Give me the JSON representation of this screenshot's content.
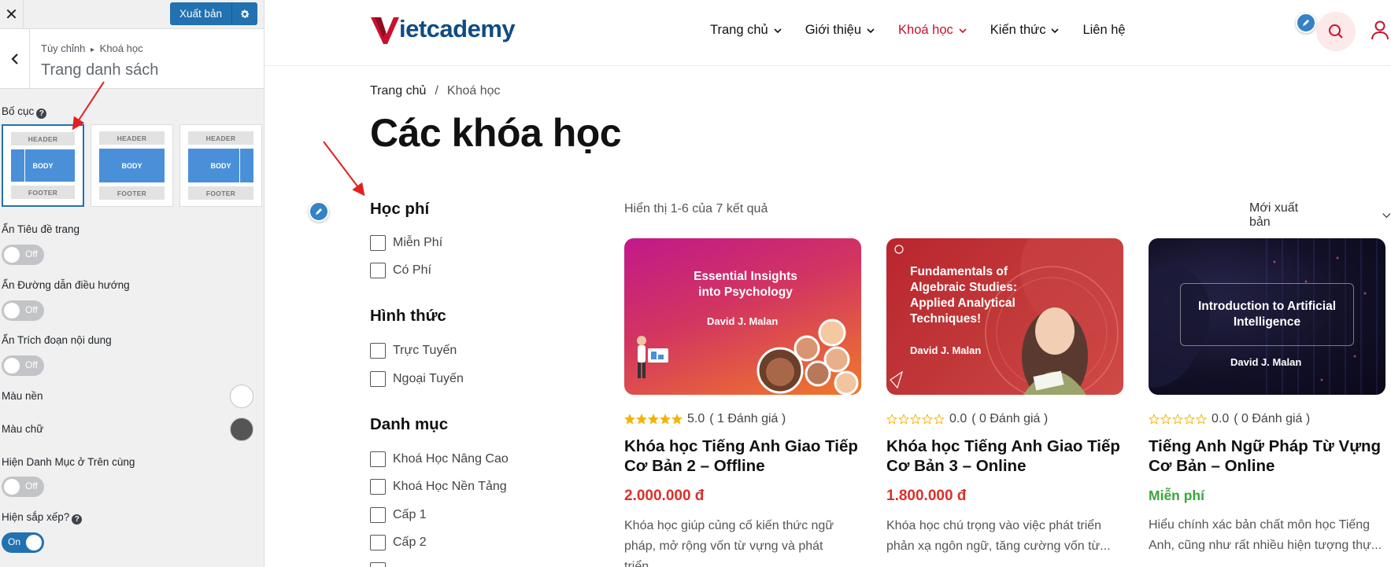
{
  "customizer": {
    "close_label": "✕",
    "publish_label": "Xuất bản",
    "breadcrumb": {
      "root": "Tùy chỉnh",
      "separator": "▸",
      "current": "Khoá học"
    },
    "section_title": "Trang danh sách",
    "layout": {
      "label": "Bố cục",
      "options": [
        {
          "header": "HEADER",
          "body": "BODY",
          "footer": "FOOTER",
          "variant": "left-sidebar",
          "selected": true
        },
        {
          "header": "HEADER",
          "body": "BODY",
          "footer": "FOOTER",
          "variant": "full-width",
          "selected": false
        },
        {
          "header": "HEADER",
          "body": "BODY",
          "footer": "FOOTER",
          "variant": "right-sidebar",
          "selected": false
        }
      ]
    },
    "controls": [
      {
        "label": "Ẩn Tiêu đề trang",
        "state": "Off"
      },
      {
        "label": "Ẩn Đường dẫn điều hướng",
        "state": "Off"
      },
      {
        "label": "Ẩn Trích đoạn nội dung",
        "state": "Off"
      }
    ],
    "bg_color": {
      "label": "Màu nền",
      "value": "#ffffff"
    },
    "text_color": {
      "label": "Màu chữ",
      "value": "#555555"
    },
    "show_category_top": {
      "label": "Hiện Danh Mục ở Trên cùng",
      "state": "Off"
    },
    "show_sort": {
      "label": "Hiện sắp xếp?",
      "state": "On"
    }
  },
  "site": {
    "logo": {
      "letter": "V",
      "text": "ietcademy"
    },
    "nav": [
      {
        "label": "Trang chủ",
        "dropdown": true,
        "active": false
      },
      {
        "label": "Giới thiệu",
        "dropdown": true,
        "active": false
      },
      {
        "label": "Khoá học",
        "dropdown": true,
        "active": true
      },
      {
        "label": "Kiến thức",
        "dropdown": true,
        "active": false
      },
      {
        "label": "Liên hệ",
        "dropdown": false,
        "active": false
      }
    ],
    "breadcrumb": {
      "home": "Trang chủ",
      "sep": "/",
      "current": "Khoá học"
    },
    "page_title": "Các khóa học",
    "filters": [
      {
        "title": "Học phí",
        "options": [
          "Miễn Phí",
          "Có Phí"
        ]
      },
      {
        "title": "Hình thức",
        "options": [
          "Trực Tuyến",
          "Ngoại Tuyến"
        ]
      },
      {
        "title": "Danh mục",
        "options": [
          "Khoá Học Nâng Cao",
          "Khoá Học Nền Tảng",
          "Cấp 1",
          "Cấp 2"
        ]
      }
    ],
    "results_text": "Hiển thị 1-6 của 7 kết quả",
    "sort_label": "Mới xuất bản",
    "courses": [
      {
        "thumb_title": "Essential Insights into Psychology",
        "thumb_author": "David J. Malan",
        "stars": 5,
        "rating": "5.0",
        "reviews": "( 1 Đánh giá )",
        "title": "Khóa học Tiếng Anh Giao Tiếp Cơ Bản 2 – Offline",
        "price": "2.000.000 đ",
        "free": false,
        "excerpt": "Khóa học giúp củng cố kiến thức ngữ pháp, mở rộng vốn từ vựng và phát triển..."
      },
      {
        "thumb_title": "Fundamentals of Algebraic Studies: Applied Analytical Techniques!",
        "thumb_author": "David J. Malan",
        "stars": 0,
        "rating": "0.0",
        "reviews": "( 0 Đánh giá )",
        "title": "Khóa học Tiếng Anh Giao Tiếp Cơ Bản 3 – Online",
        "price": "1.800.000 đ",
        "free": false,
        "excerpt": "Khóa học chú trọng vào việc phát triển phản xạ ngôn ngữ, tăng cường vốn từ..."
      },
      {
        "thumb_title": "Introduction to Artificial Intelligence",
        "thumb_author": "David J. Malan",
        "stars": 0,
        "rating": "0.0",
        "reviews": "( 0 Đánh giá )",
        "title": "Tiếng Anh Ngữ Pháp Từ Vựng Cơ Bản – Online",
        "price": "Miễn phí",
        "free": true,
        "excerpt": "Hiểu chính xác bản chất môn học Tiếng Anh, cũng như rất nhiều hiện tượng thự..."
      }
    ],
    "colors": {
      "brand_red": "#c8102e",
      "brand_blue": "#0f4c81",
      "price_red": "#d9302b",
      "free_green": "#3aa639",
      "accent": "#2271b1"
    }
  }
}
